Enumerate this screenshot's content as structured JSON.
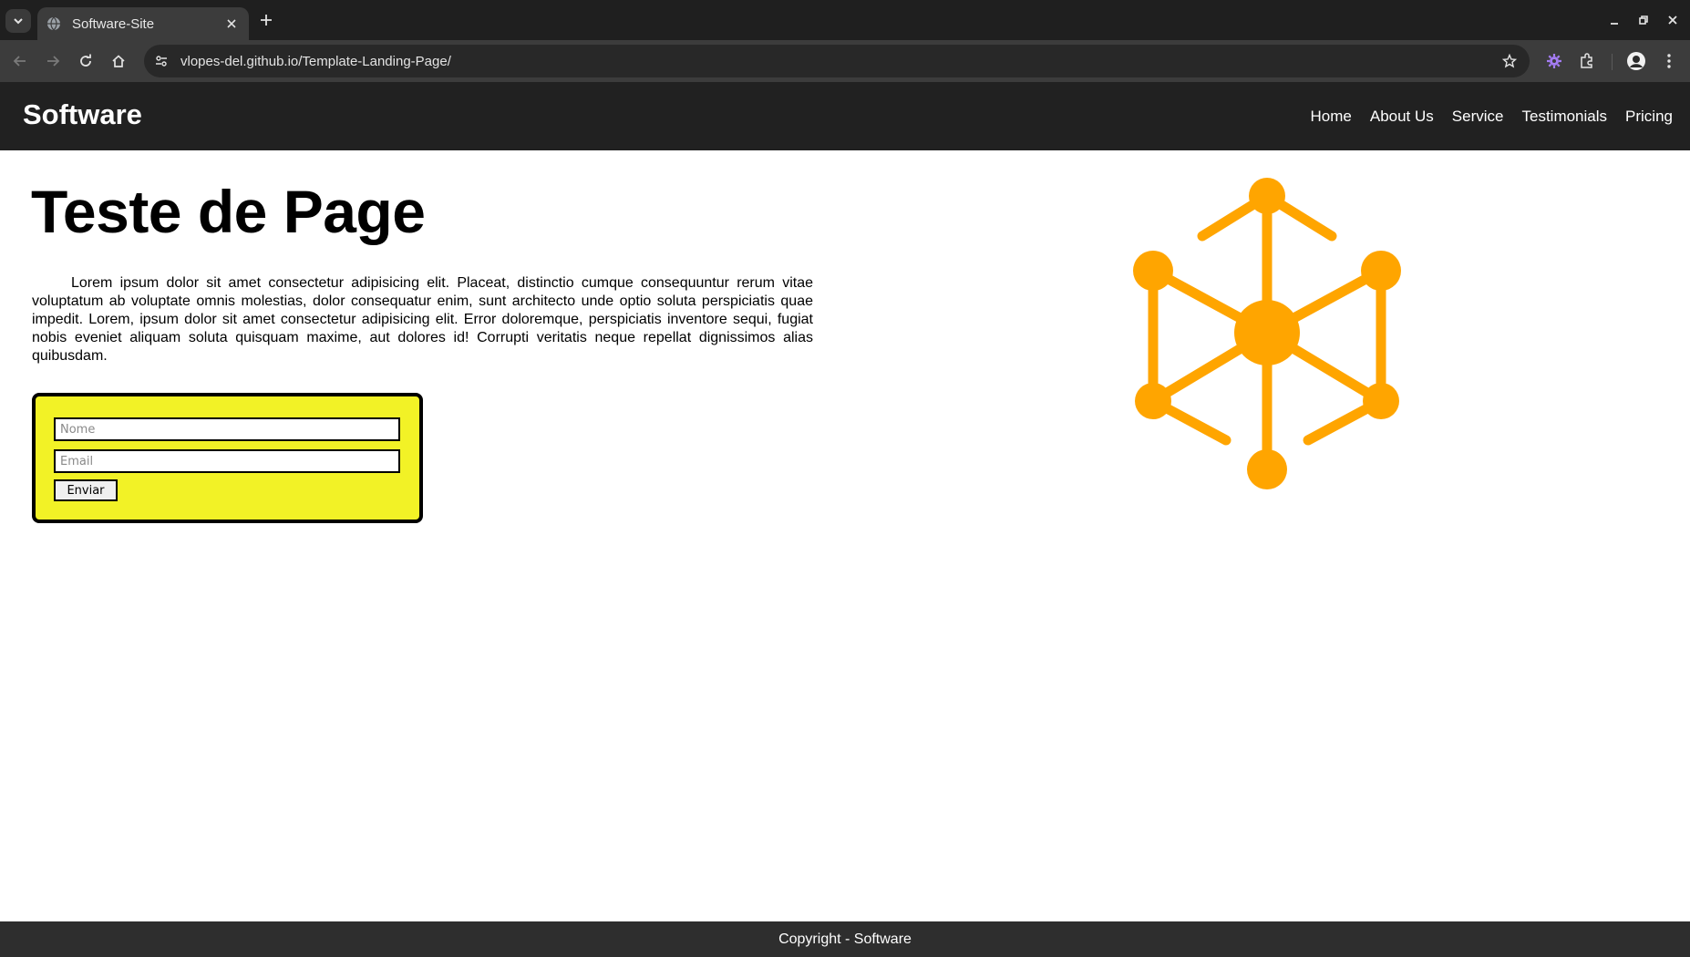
{
  "browser": {
    "tab_title": "Software-Site",
    "url": "vlopes-del.github.io/Template-Landing-Page/",
    "icons": [
      "tab-list-icon",
      "globe-icon",
      "close-icon",
      "plus-icon",
      "minimize-icon",
      "restore-icon",
      "close-window-icon",
      "back-icon",
      "forward-icon",
      "reload-icon",
      "home-icon",
      "site-info-icon",
      "star-icon",
      "extension-gear-icon",
      "puzzle-icon",
      "profile-avatar",
      "more-menu-icon"
    ]
  },
  "header": {
    "brand": "Software",
    "nav": [
      {
        "label": "Home"
      },
      {
        "label": "About Us"
      },
      {
        "label": "Service"
      },
      {
        "label": "Testimonials"
      },
      {
        "label": "Pricing"
      }
    ]
  },
  "hero": {
    "title": "Teste de Page",
    "text": "Lorem ipsum dolor sit amet consectetur adipisicing elit. Placeat, distinctio cumque consequuntur rerum vitae voluptatum ab voluptate omnis molestias, dolor consequatur enim, sunt architecto unde optio soluta perspiciatis quae impedit. Lorem, ipsum dolor sit amet consectetur adipisicing elit. Error doloremque, perspiciatis inventore sequi, fugiat nobis eveniet aliquam soluta quisquam maxime, aut dolores id! Corrupti veritatis neque repellat dignissimos alias quibusdam.",
    "logo_color": "#FFA500"
  },
  "form": {
    "name_placeholder": "Nome",
    "name_value": "",
    "email_placeholder": "Email",
    "email_value": "",
    "submit_label": "Enviar",
    "background": "#F2F226"
  },
  "footer": {
    "text": "Copyright - Software"
  }
}
